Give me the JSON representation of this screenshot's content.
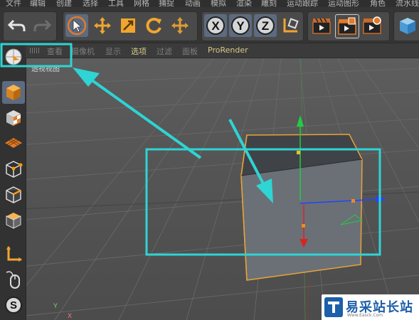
{
  "menu": [
    "文件",
    "编辑",
    "创建",
    "选择",
    "工具",
    "网格",
    "捕捉",
    "动画",
    "模拟",
    "渲染",
    "雕刻",
    "运动跟踪",
    "运动图形",
    "角色",
    "流水线"
  ],
  "viewport_menu": [
    "查看",
    "摄像机",
    "显示",
    "选项",
    "过滤",
    "面板",
    "ProRender"
  ],
  "viewport_label": "透视视图",
  "axis_labels": {
    "y": "Y",
    "x": "X"
  },
  "toolbar": {
    "axis_x": "X",
    "axis_y": "Y",
    "axis_z": "Z"
  },
  "palette_buttons": [
    "cube-model",
    "texture",
    "polygon",
    "points",
    "edges",
    "polygons",
    "object-axis",
    "mouse",
    "snap"
  ],
  "snap_label": "S",
  "annotations": {
    "highlight_color": "#2fd4d4"
  },
  "watermark": {
    "title": "易采站长站",
    "subtitle": "Www.Easck.Com"
  },
  "colors": {
    "selection": "#e8a23a",
    "axis_x": "#2244ff",
    "axis_y": "#22cc44",
    "axis_z": "#dd2222",
    "active_button": "#5d6b80"
  }
}
